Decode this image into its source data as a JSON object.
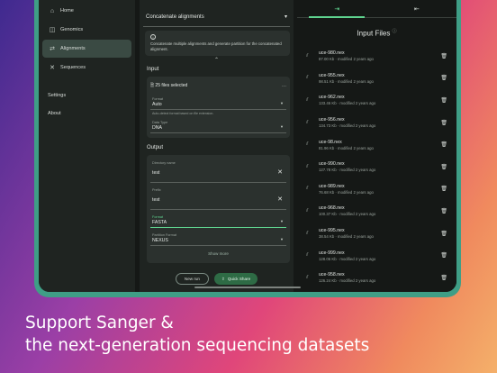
{
  "sidebar": {
    "items": [
      {
        "icon": "home-icon",
        "glyph": "⌂",
        "label": "Home",
        "selected": false
      },
      {
        "icon": "genomics-icon",
        "glyph": "◫",
        "label": "Genomics",
        "selected": false
      },
      {
        "icon": "alignments-icon",
        "glyph": "⇄",
        "label": "Alignments",
        "selected": true
      },
      {
        "icon": "sequences-icon",
        "glyph": "✕",
        "label": "Sequences",
        "selected": false
      }
    ],
    "settings_label": "Settings",
    "about_label": "About"
  },
  "main": {
    "dropdown_label": "Concatenate alignments",
    "info_text": "Concatenate multiple alignments and generate partition for the concatenated alignment.",
    "input_section": "Input",
    "files_selected": "25 files selected",
    "format": {
      "label": "Format",
      "value": "Auto",
      "hint": "Auto-detect format based on file extension."
    },
    "data_type": {
      "label": "Data Type",
      "value": "DNA"
    },
    "output_section": "Output",
    "directory": {
      "label": "Directory name",
      "value": "test"
    },
    "prefix": {
      "label": "Prefix",
      "value": "test"
    },
    "out_format": {
      "label": "Format",
      "value": "FASTA"
    },
    "partition_format": {
      "label": "Partition Format",
      "value": "NEXUS"
    },
    "show_more": "Show more",
    "new_run": "New run",
    "quick_share": "Quick Share"
  },
  "right": {
    "title": "Input Files",
    "files": [
      {
        "name": "uce-980.nex",
        "meta": "87.00 Kb · modified 2 years ago"
      },
      {
        "name": "uce-955.nex",
        "meta": "98.51 Kb · modified 2 years ago"
      },
      {
        "name": "uce-962.nex",
        "meta": "133.46 Kb · modified 2 years ago"
      },
      {
        "name": "uce-956.nex",
        "meta": "134.73 Kb · modified 2 years ago"
      },
      {
        "name": "uce-98.nex",
        "meta": "81.96 Kb · modified 2 years ago"
      },
      {
        "name": "uce-990.nex",
        "meta": "127.78 Kb · modified 2 years ago"
      },
      {
        "name": "uce-989.nex",
        "meta": "76.68 Kb · modified 2 years ago"
      },
      {
        "name": "uce-968.nex",
        "meta": "100.37 Kb · modified 2 years ago"
      },
      {
        "name": "uce-995.nex",
        "meta": "38.54 Kb · modified 2 years ago"
      },
      {
        "name": "uce-999.nex",
        "meta": "128.06 Kb · modified 2 years ago"
      },
      {
        "name": "uce-958.nex",
        "meta": "126.24 Kb · modified 2 years ago"
      }
    ]
  },
  "caption": {
    "line1": "Support Sanger &",
    "line2": "the next-generation sequencing datasets"
  },
  "colors": {
    "accent": "#5fd38f",
    "device": "#3f9e86",
    "panel": "#1f2421"
  }
}
